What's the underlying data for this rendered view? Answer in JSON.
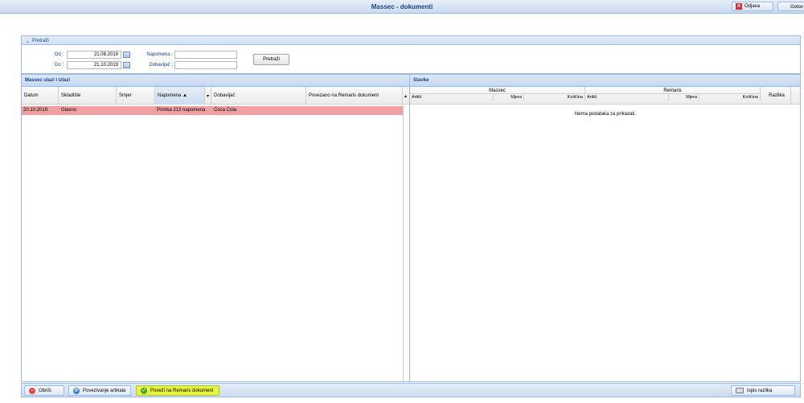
{
  "window": {
    "title": "Massec - dokumenti"
  },
  "header_buttons": {
    "odjava": "Odjava",
    "gotovo": "Gotov"
  },
  "search": {
    "panel_label": "Pretraži",
    "od_label": "Od :",
    "od_value": "21.08.2019",
    "do_label": "Do :",
    "do_value": "21.10.2019",
    "napomena_label": "Napomena :",
    "napomena_value": "",
    "dobavljac_label": "Dobavljač :",
    "dobavljac_value": "",
    "submit_label": "Pretraži"
  },
  "left_grid": {
    "title": "Massec ulazi i izlazi",
    "columns": [
      "Datum",
      "Skladište",
      "Smjer",
      "Napomena ▲",
      "Dobavljač",
      "Povezano na Remaris dokument"
    ],
    "rows": [
      {
        "datum": "20.10.2019.",
        "skladiste": "Glavno",
        "smjer": "",
        "napomena": "Primka 213 napomena",
        "dobavljac": "Coca Cola",
        "povezano": ""
      }
    ]
  },
  "right_grid": {
    "title": "Stavke",
    "group_massec": "Massec",
    "group_remaris": "Remaris",
    "razlika": "Razlika",
    "massec_cols": [
      "Artikl",
      "Mjera",
      "Količina"
    ],
    "remaris_cols": [
      "Artikl",
      "Mjera",
      "Količina"
    ],
    "empty_text": "Nema podataka za prikazati."
  },
  "toolbar": {
    "obrisi": "Obriši",
    "povezivanje": "Povezivanje artikala",
    "povezi": "Poveži na Remaris dokument",
    "ispis": "Ispis razlika"
  },
  "colors": {
    "selected_row": "#f0a0a3",
    "highlight_button": "#e6f53a"
  }
}
